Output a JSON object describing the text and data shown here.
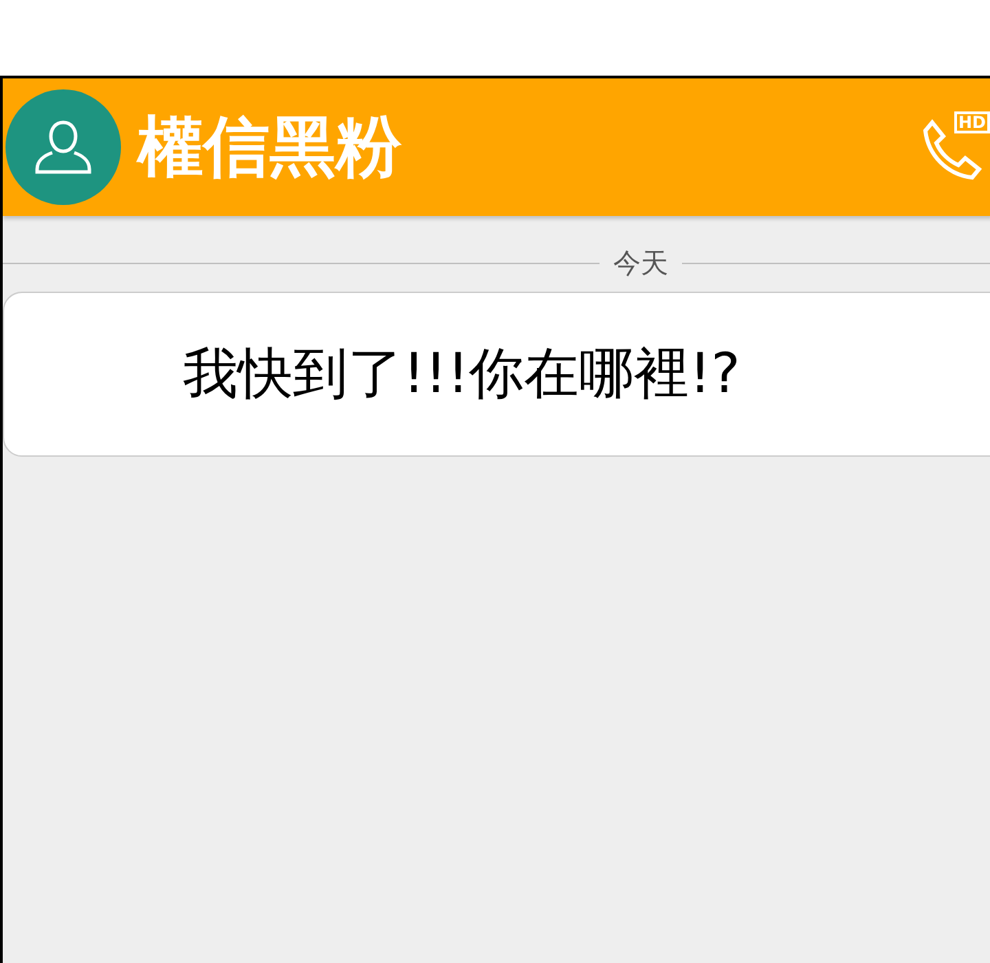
{
  "header": {
    "title": "權信黑粉",
    "call_badge": "HD"
  },
  "date_divider": "今天",
  "messages": [
    {
      "text": "我快到了!!!你在哪裡!?"
    }
  ]
}
